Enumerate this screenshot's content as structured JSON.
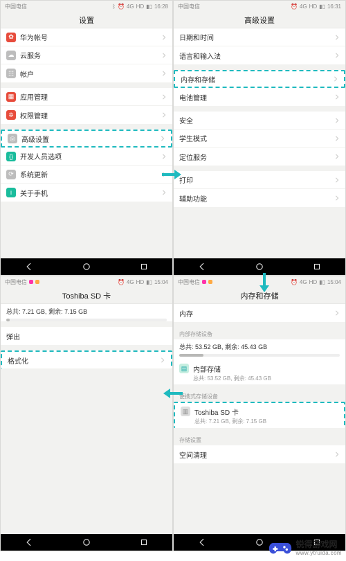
{
  "status": {
    "carrier": "中国电信",
    "net": "4G",
    "hd": "HD",
    "alarm": "⏰"
  },
  "times": {
    "s1": "16:28",
    "s2": "16:31",
    "s3": "15:04",
    "s4": "15:04"
  },
  "s1": {
    "title": "设置",
    "g1": [
      {
        "icon": "#e74c3c",
        "glyph": "✿",
        "label": "华为帐号"
      },
      {
        "icon": "#7f8c8d",
        "glyph": "☁",
        "label": "云服务"
      },
      {
        "icon": "#7f8c8d",
        "glyph": "⛯",
        "label": "帐户"
      }
    ],
    "g2": [
      {
        "icon": "#e74c3c",
        "glyph": "▦",
        "label": "应用管理"
      },
      {
        "icon": "#e74c3c",
        "glyph": "✲",
        "label": "权限管理"
      }
    ],
    "g3": [
      {
        "icon": "#7f8c8d",
        "glyph": "◎",
        "label": "高级设置",
        "hl": true
      },
      {
        "icon": "#1abc9c",
        "glyph": "{}",
        "label": "开发人员选项"
      },
      {
        "icon": "#7f8c8d",
        "glyph": "⟳",
        "label": "系统更新"
      },
      {
        "icon": "#1abc9c",
        "glyph": "i",
        "label": "关于手机"
      }
    ]
  },
  "s2": {
    "title": "高级设置",
    "g1": [
      {
        "label": "日期和时间"
      },
      {
        "label": "语言和输入法"
      }
    ],
    "g2": [
      {
        "label": "内存和存储",
        "hl": true
      },
      {
        "label": "电池管理"
      }
    ],
    "g3": [
      {
        "label": "安全"
      },
      {
        "label": "学生模式"
      },
      {
        "label": "定位服务"
      }
    ],
    "g4": [
      {
        "label": "打印"
      },
      {
        "label": "辅助功能"
      }
    ]
  },
  "s3": {
    "title": "Toshiba SD 卡",
    "total_label": "总共:",
    "total_val": "7.21 GB,",
    "remain_label": "剩余:",
    "remain_val": "7.15 GB",
    "eject": "弹出",
    "format": "格式化"
  },
  "s4": {
    "title": "内存和存储",
    "mem": "内存",
    "sec1": "内部存储设备",
    "total_label": "总共:",
    "total_val": "53.52 GB,",
    "remain_label": "剩余:",
    "remain_val": "45.43 GB",
    "internal": "内部存储",
    "internal_sub": "总共: 53.52 GB, 剩余: 45.43 GB",
    "sec2": "便携式存储设备",
    "sd": "Toshiba SD 卡",
    "sd_sub": "总共: 7.21 GB, 剩余: 7.15 GB",
    "sec3": "存储设置",
    "clean": "空间清理"
  },
  "wm": {
    "title": "锐得游戏网",
    "url": "www.ytruida.com"
  }
}
